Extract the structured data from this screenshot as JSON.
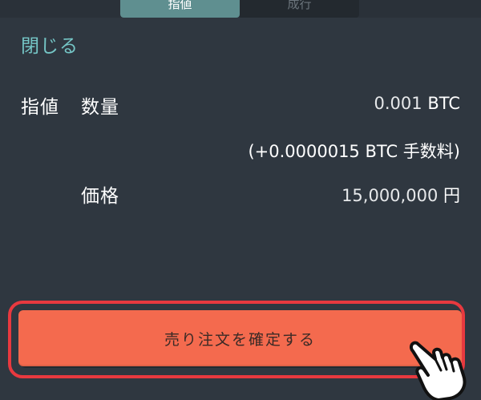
{
  "tabs": [
    {
      "label": "指値",
      "active": true
    },
    {
      "label": "成行",
      "active": false
    }
  ],
  "close_label": "閉じる",
  "order_type": "指値",
  "quantity": {
    "label": "数量",
    "value": "0.001",
    "unit": "BTC",
    "fee_note": "(+0.0000015 BTC 手数料)"
  },
  "price": {
    "label": "価格",
    "value": "15,000,000",
    "unit": "円"
  },
  "submit_label": "売り注文を確定する",
  "colors": {
    "background": "#2f3740",
    "accent": "#75c6c6",
    "sell_button": "#f46a4e",
    "highlight_outline": "#e8393f",
    "active_tab": "#5f8f90"
  },
  "icons": {
    "pointer": "pointing-hand-icon"
  }
}
